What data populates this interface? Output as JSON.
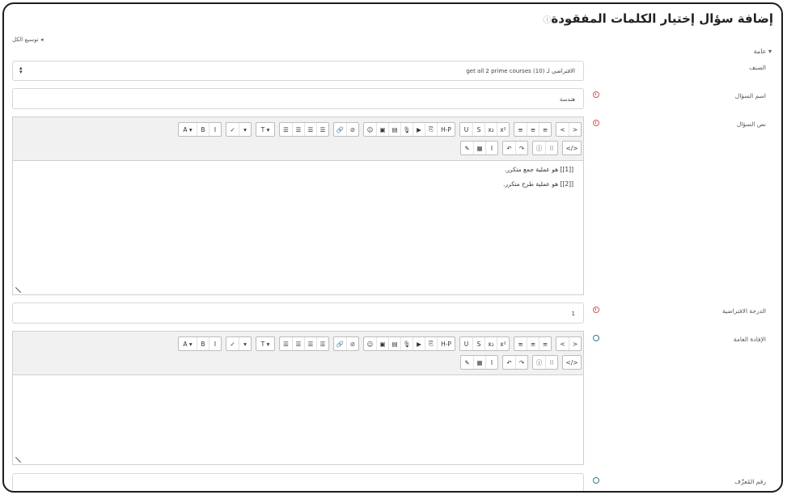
{
  "header": {
    "title": "إضافة سؤال إختيار الكلمات المفقودة",
    "help_icon": "question-circle-icon"
  },
  "expand_all": "◂ توسيع الكل",
  "section": {
    "label": "▾ عامة"
  },
  "category": {
    "label": "الصنف",
    "value": "الافتراضي لـ get all 2 prime courses (10)",
    "caret": "▴▾"
  },
  "question_name": {
    "label": "اسم السؤال",
    "value": "هندسة"
  },
  "question_text": {
    "label": "نص السؤال",
    "lines": [
      "[[1]] هو عملية جمع متكرر.",
      "[[2]] هو عملية طرح متكرر."
    ]
  },
  "default_mark": {
    "label": "الدرجة الافتراضية",
    "value": "1"
  },
  "general_feedback": {
    "label": "الإفادة العامة"
  },
  "id_number": {
    "label": "رقم المُعرِّف"
  },
  "toolbar": {
    "row1_groups": [
      [
        "A ▾",
        "B",
        "I"
      ],
      [
        "✓",
        "▾"
      ],
      [
        "T ▾"
      ],
      [
        "☰",
        "☰",
        "☰",
        "☰"
      ],
      [
        "🔗",
        "⊘"
      ],
      [
        "☺",
        "▣",
        "▤",
        "🎙",
        "▶",
        "⎘",
        "H-P"
      ],
      [
        "U",
        "S",
        "x₂",
        "x²"
      ],
      [
        "≡",
        "≡",
        "≡"
      ],
      [
        "<",
        ">"
      ]
    ],
    "row2_groups": [
      [
        "✎",
        "▦",
        "I"
      ],
      [
        "↶",
        "↷"
      ],
      [
        "ⓘ",
        "⁝⁝"
      ],
      [
        "</>"
      ]
    ]
  },
  "colors": {
    "required": "#d9534f",
    "help": "#2f7a8f",
    "toolbar_bg": "#f1f1f1"
  }
}
